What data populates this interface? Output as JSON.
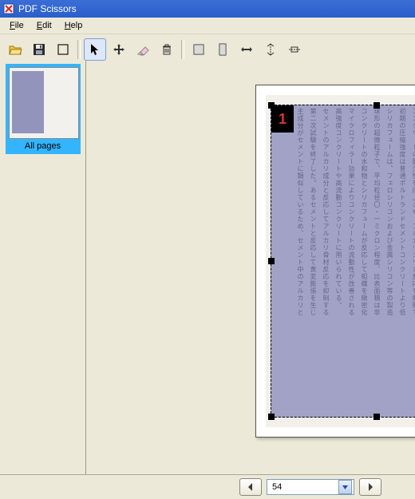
{
  "window": {
    "title": "PDF Scissors"
  },
  "menu": {
    "file": "File",
    "edit": "Edit",
    "help": "Help"
  },
  "toolbar": {
    "open": "open",
    "save": "save",
    "crop": "crop-rect",
    "arrow": "arrow",
    "move": "move",
    "erase": "erase",
    "delete": "delete",
    "fit_w": "fit-width",
    "fit_h": "fit-height",
    "resize_h": "resize-horizontal",
    "align_v": "align-vertical",
    "align_h": "align-horizontal"
  },
  "sidebar": {
    "thumb_label": "All pages"
  },
  "page": {
    "badge": "1"
  },
  "nav": {
    "prev_icon": "chevron-left",
    "next_icon": "chevron-right",
    "current": "54"
  },
  "colors": {
    "title_bg": "#2f63cf",
    "selection_fill": "#6b6fa8",
    "thumb_highlight": "#33b4ff"
  }
}
